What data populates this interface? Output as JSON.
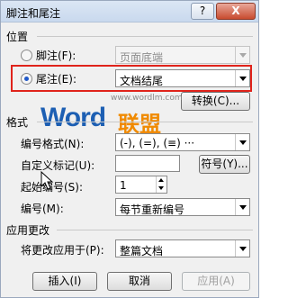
{
  "window": {
    "title": "脚注和尾注",
    "help_label": "?",
    "close_label": "X"
  },
  "location": {
    "group_label": "位置",
    "footnote": {
      "label": "脚注(F):",
      "value": "页面底端",
      "selected": false
    },
    "endnote": {
      "label": "尾注(E):",
      "value": "文档结尾",
      "selected": true
    },
    "convert_label": "转换(C)..."
  },
  "watermark": {
    "url": "www.wordlm.com",
    "word": "Word",
    "cn": "联盟"
  },
  "format": {
    "group_label": "格式",
    "number_format_label": "编号格式(N):",
    "number_format_value": "(-), (=), (≡) ···",
    "custom_mark_label": "自定义标记(U):",
    "custom_mark_value": "",
    "symbol_label": "符号(Y)...",
    "start_at_label": "起始编号(S):",
    "start_at_value": "1",
    "numbering_label": "编号(M):",
    "numbering_value": "每节重新编号"
  },
  "apply": {
    "group_label": "应用更改",
    "apply_to_label": "将更改应用于(P):",
    "apply_to_value": "整篇文档"
  },
  "buttons": {
    "insert": "插入(I)",
    "cancel": "取消",
    "apply": "应用(A)"
  },
  "colors": {
    "highlight": "#e0231b",
    "watermark_blue": "#1d5fb3",
    "watermark_orange": "#f08a00"
  },
  "icons": {
    "cursor": "pointer-cursor-icon"
  }
}
